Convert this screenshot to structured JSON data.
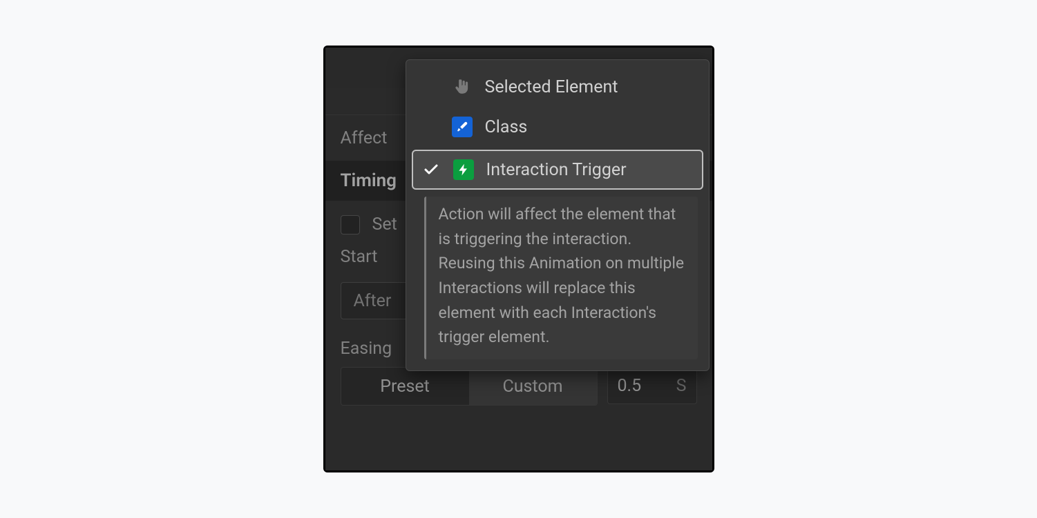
{
  "panel": {
    "affect_label": "Affect",
    "section_timing": "Timing",
    "set_label": "Set",
    "start_label": "Start",
    "start_field_value": "After",
    "easing_label": "Easing",
    "preset_label": "Preset",
    "custom_label": "Custom",
    "duration_value": "0.5",
    "duration_unit": "S"
  },
  "dropdown": {
    "items": [
      {
        "label": "Selected Element",
        "icon": "hand"
      },
      {
        "label": "Class",
        "icon": "class"
      },
      {
        "label": "Interaction Trigger",
        "icon": "bolt",
        "selected": true
      }
    ],
    "description": "Action will affect the element that is triggering the interaction. Reusing this Animation on multiple Interactions will replace this element with each Interaction's trigger element."
  }
}
